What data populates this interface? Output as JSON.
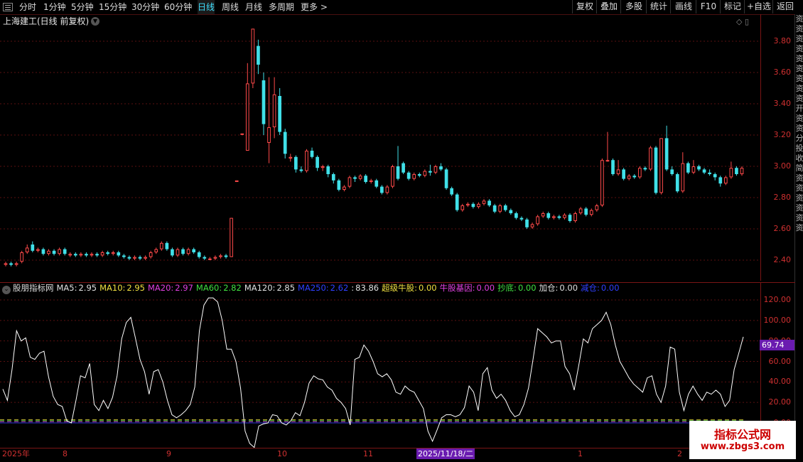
{
  "topbar": {
    "periods": [
      {
        "label": "分时",
        "active": false
      },
      {
        "label": "1分钟",
        "active": false
      },
      {
        "label": "5分钟",
        "active": false
      },
      {
        "label": "15分钟",
        "active": false
      },
      {
        "label": "30分钟",
        "active": false
      },
      {
        "label": "60分钟",
        "active": false
      },
      {
        "label": "日线",
        "active": true
      },
      {
        "label": "周线",
        "active": false
      },
      {
        "label": "月线",
        "active": false
      },
      {
        "label": "多周期",
        "active": false
      },
      {
        "label": "更多 >",
        "active": false
      }
    ],
    "actions": [
      "复权",
      "叠加",
      "多股",
      "统计",
      "画线",
      "F10",
      "标记",
      "+自选",
      "返回"
    ]
  },
  "stock": {
    "title": "上海建工(日线 前复权)"
  },
  "corner_icons": "◇ ▯",
  "price_axis": {
    "ticks": [
      "3.80",
      "3.60",
      "3.40",
      "3.20",
      "3.00",
      "2.80",
      "2.60",
      "2.40"
    ]
  },
  "side_strip": {
    "chars": [
      "资",
      "资",
      "资",
      "资",
      "资",
      "资",
      "资",
      "资",
      "资",
      "开",
      "资",
      "资",
      "分",
      "投",
      "收",
      "简",
      "资",
      "资",
      "资",
      "资",
      "资",
      "资"
    ]
  },
  "indicator": {
    "name": "股朋指标网",
    "items": [
      {
        "label": "MA5:",
        "value": "2.95",
        "color": "#e0e0e0"
      },
      {
        "label": "MA10:",
        "value": "2.95",
        "color": "#f0e040"
      },
      {
        "label": "MA20:",
        "value": "2.97",
        "color": "#e040e0"
      },
      {
        "label": "MA60:",
        "value": "2.82",
        "color": "#40e040"
      },
      {
        "label": "MA120:",
        "value": "2.85",
        "color": "#e0e0e0"
      },
      {
        "label": "MA250:",
        "value": "2.62",
        "color": "#3040ff"
      },
      {
        "label": ":",
        "value": "83.86",
        "color": "#e0e0e0"
      },
      {
        "label": "超级牛股:",
        "value": "0.00",
        "color": "#f0e040"
      },
      {
        "label": "牛股基因:",
        "value": "0.00",
        "color": "#e040e0"
      },
      {
        "label": "抄底:",
        "value": "0.00",
        "color": "#40e040"
      },
      {
        "label": "加仓:",
        "value": "0.00",
        "color": "#e0e0e0"
      },
      {
        "label": "减仓:",
        "value": "0.00",
        "color": "#3040ff"
      }
    ],
    "axis_ticks": [
      "120.00",
      "100.00",
      "80.00",
      "60.00",
      "40.00",
      "20.00",
      "0.00"
    ],
    "current_badge": "69.74"
  },
  "date_axis": {
    "labels": [
      {
        "text": "2025年",
        "selected": false
      },
      {
        "text": "8",
        "selected": false
      },
      {
        "text": "9",
        "selected": false
      },
      {
        "text": "10",
        "selected": false
      },
      {
        "text": "11",
        "selected": false
      },
      {
        "text": "2025/11/18/二",
        "selected": true
      },
      {
        "text": "1",
        "selected": false
      },
      {
        "text": "2",
        "selected": false
      }
    ]
  },
  "watermark": {
    "name": "指标公式网",
    "url": "www.zbgs3.com"
  },
  "colors": {
    "up": "#ff4a4a",
    "down": "#40e0e8",
    "grid": "#5a1010",
    "axis": "#d03030"
  },
  "chart_data": {
    "type": "candlestick",
    "ylim": [
      2.35,
      3.9
    ],
    "candles": [
      [
        2.37,
        2.38,
        2.39,
        2.36
      ],
      [
        2.38,
        2.37,
        2.39,
        2.36
      ],
      [
        2.37,
        2.38,
        2.39,
        2.36
      ],
      [
        2.39,
        2.45,
        2.46,
        2.38
      ],
      [
        2.45,
        2.48,
        2.5,
        2.44
      ],
      [
        2.5,
        2.46,
        2.52,
        2.45
      ],
      [
        2.46,
        2.47,
        2.48,
        2.45
      ],
      [
        2.47,
        2.44,
        2.48,
        2.43
      ],
      [
        2.44,
        2.46,
        2.47,
        2.43
      ],
      [
        2.46,
        2.44,
        2.47,
        2.43
      ],
      [
        2.44,
        2.47,
        2.48,
        2.43
      ],
      [
        2.47,
        2.44,
        2.48,
        2.43
      ],
      [
        2.43,
        2.44,
        2.45,
        2.42
      ],
      [
        2.44,
        2.43,
        2.45,
        2.42
      ],
      [
        2.43,
        2.44,
        2.45,
        2.42
      ],
      [
        2.44,
        2.43,
        2.45,
        2.42
      ],
      [
        2.43,
        2.44,
        2.45,
        2.42
      ],
      [
        2.44,
        2.43,
        2.45,
        2.42
      ],
      [
        2.43,
        2.45,
        2.46,
        2.42
      ],
      [
        2.45,
        2.44,
        2.46,
        2.43
      ],
      [
        2.44,
        2.45,
        2.46,
        2.43
      ],
      [
        2.45,
        2.43,
        2.46,
        2.42
      ],
      [
        2.43,
        2.42,
        2.44,
        2.41
      ],
      [
        2.42,
        2.41,
        2.43,
        2.4
      ],
      [
        2.41,
        2.42,
        2.43,
        2.4
      ],
      [
        2.42,
        2.41,
        2.43,
        2.4
      ],
      [
        2.41,
        2.42,
        2.43,
        2.4
      ],
      [
        2.42,
        2.45,
        2.46,
        2.41
      ],
      [
        2.45,
        2.47,
        2.48,
        2.44
      ],
      [
        2.47,
        2.51,
        2.52,
        2.46
      ],
      [
        2.51,
        2.47,
        2.52,
        2.46
      ],
      [
        2.47,
        2.43,
        2.48,
        2.42
      ],
      [
        2.43,
        2.47,
        2.48,
        2.42
      ],
      [
        2.47,
        2.44,
        2.48,
        2.43
      ],
      [
        2.44,
        2.47,
        2.48,
        2.43
      ],
      [
        2.47,
        2.45,
        2.48,
        2.44
      ],
      [
        2.45,
        2.42,
        2.46,
        2.41
      ],
      [
        2.42,
        2.41,
        2.43,
        2.4
      ],
      [
        2.41,
        2.41,
        2.42,
        2.4
      ],
      [
        2.41,
        2.42,
        2.43,
        2.4
      ],
      [
        2.42,
        2.43,
        2.44,
        2.41
      ],
      [
        2.43,
        2.42,
        2.44,
        2.41
      ],
      [
        2.42,
        2.67,
        2.67,
        2.42
      ],
      [
        2.9,
        2.91,
        2.91,
        2.9
      ],
      [
        3.21,
        3.21,
        3.21,
        3.21
      ],
      [
        3.1,
        3.53,
        3.66,
        3.1
      ],
      [
        3.53,
        3.88,
        3.88,
        3.5
      ],
      [
        3.77,
        3.65,
        3.81,
        3.59
      ],
      [
        3.55,
        3.27,
        3.6,
        3.2
      ],
      [
        3.15,
        3.25,
        3.57,
        3.02
      ],
      [
        3.25,
        3.46,
        3.57,
        3.18
      ],
      [
        3.45,
        3.22,
        3.5,
        3.2
      ],
      [
        3.22,
        3.08,
        3.24,
        3.05
      ],
      [
        3.05,
        3.06,
        3.08,
        3.03
      ],
      [
        3.06,
        2.98,
        3.07,
        2.96
      ],
      [
        2.98,
        2.97,
        3.0,
        2.96
      ],
      [
        2.97,
        3.1,
        3.11,
        2.96
      ],
      [
        3.1,
        3.06,
        3.12,
        3.05
      ],
      [
        3.06,
        2.99,
        3.07,
        2.97
      ],
      [
        2.99,
        3.0,
        3.01,
        2.97
      ],
      [
        3.0,
        2.95,
        3.01,
        2.93
      ],
      [
        2.95,
        2.91,
        2.96,
        2.89
      ],
      [
        2.91,
        2.85,
        2.92,
        2.84
      ],
      [
        2.85,
        2.87,
        2.88,
        2.84
      ],
      [
        2.87,
        2.93,
        2.94,
        2.86
      ],
      [
        2.93,
        2.92,
        2.94,
        2.9
      ],
      [
        2.92,
        2.94,
        2.95,
        2.91
      ],
      [
        2.94,
        2.9,
        2.95,
        2.89
      ],
      [
        2.9,
        2.91,
        2.92,
        2.89
      ],
      [
        2.91,
        2.87,
        2.92,
        2.86
      ],
      [
        2.87,
        2.83,
        2.88,
        2.82
      ],
      [
        2.83,
        2.87,
        2.88,
        2.82
      ],
      [
        2.87,
        3.0,
        3.01,
        2.86
      ],
      [
        3.0,
        2.92,
        3.13,
        2.91
      ],
      [
        3.02,
        2.96,
        3.03,
        2.95
      ],
      [
        2.96,
        2.92,
        2.97,
        2.91
      ],
      [
        2.92,
        2.95,
        2.96,
        2.91
      ],
      [
        2.95,
        2.94,
        2.96,
        2.93
      ],
      [
        2.94,
        2.97,
        2.98,
        2.93
      ],
      [
        2.97,
        2.96,
        3.01,
        2.94
      ],
      [
        2.96,
        3.0,
        3.01,
        2.95
      ],
      [
        3.0,
        2.98,
        3.02,
        2.97
      ],
      [
        2.98,
        2.86,
        2.99,
        2.85
      ],
      [
        2.86,
        2.82,
        2.87,
        2.81
      ],
      [
        2.82,
        2.72,
        2.83,
        2.71
      ],
      [
        2.72,
        2.75,
        2.76,
        2.71
      ],
      [
        2.75,
        2.76,
        2.77,
        2.74
      ],
      [
        2.76,
        2.74,
        2.77,
        2.73
      ],
      [
        2.74,
        2.76,
        2.77,
        2.73
      ],
      [
        2.76,
        2.78,
        2.79,
        2.75
      ],
      [
        2.78,
        2.75,
        2.79,
        2.74
      ],
      [
        2.75,
        2.71,
        2.76,
        2.7
      ],
      [
        2.71,
        2.75,
        2.76,
        2.7
      ],
      [
        2.75,
        2.72,
        2.76,
        2.71
      ],
      [
        2.72,
        2.7,
        2.73,
        2.69
      ],
      [
        2.7,
        2.67,
        2.71,
        2.66
      ],
      [
        2.67,
        2.66,
        2.68,
        2.65
      ],
      [
        2.66,
        2.61,
        2.67,
        2.6
      ],
      [
        2.61,
        2.63,
        2.64,
        2.6
      ],
      [
        2.63,
        2.68,
        2.69,
        2.62
      ],
      [
        2.68,
        2.7,
        2.71,
        2.67
      ],
      [
        2.7,
        2.67,
        2.71,
        2.66
      ],
      [
        2.67,
        2.68,
        2.69,
        2.66
      ],
      [
        2.68,
        2.67,
        2.69,
        2.66
      ],
      [
        2.67,
        2.69,
        2.7,
        2.66
      ],
      [
        2.69,
        2.65,
        2.7,
        2.64
      ],
      [
        2.65,
        2.7,
        2.71,
        2.64
      ],
      [
        2.7,
        2.73,
        2.74,
        2.69
      ],
      [
        2.73,
        2.69,
        2.74,
        2.68
      ],
      [
        2.69,
        2.72,
        2.73,
        2.68
      ],
      [
        2.72,
        2.75,
        2.76,
        2.71
      ],
      [
        2.75,
        3.04,
        3.05,
        2.74
      ],
      [
        3.04,
        3.04,
        3.22,
        3.03
      ],
      [
        3.04,
        2.95,
        3.05,
        2.94
      ],
      [
        2.95,
        2.98,
        3.04,
        2.94
      ],
      [
        2.98,
        2.92,
        2.99,
        2.91
      ],
      [
        2.92,
        2.94,
        2.95,
        2.91
      ],
      [
        2.94,
        2.93,
        2.95,
        2.92
      ],
      [
        2.93,
        2.99,
        3.0,
        2.92
      ],
      [
        2.99,
        2.98,
        3.0,
        2.97
      ],
      [
        2.98,
        3.12,
        3.13,
        2.97
      ],
      [
        3.12,
        2.83,
        3.13,
        2.82
      ],
      [
        2.83,
        3.18,
        3.18,
        2.82
      ],
      [
        3.18,
        2.98,
        3.26,
        2.97
      ],
      [
        2.98,
        2.95,
        3.0,
        2.94
      ],
      [
        2.95,
        2.84,
        2.96,
        2.83
      ],
      [
        2.84,
        3.02,
        3.09,
        2.83
      ],
      [
        3.02,
        2.96,
        3.03,
        2.95
      ],
      [
        2.96,
        3.0,
        3.04,
        2.95
      ],
      [
        3.0,
        2.98,
        3.01,
        2.97
      ],
      [
        2.98,
        2.96,
        2.99,
        2.95
      ],
      [
        2.96,
        2.95,
        2.98,
        2.94
      ],
      [
        2.95,
        2.93,
        2.96,
        2.91
      ],
      [
        2.93,
        2.89,
        2.94,
        2.87
      ],
      [
        2.89,
        2.93,
        2.94,
        2.88
      ],
      [
        2.93,
        2.99,
        3.03,
        2.92
      ],
      [
        2.99,
        2.95,
        3.0,
        2.94
      ],
      [
        2.95,
        2.99,
        3.0,
        2.94
      ]
    ],
    "indicator_line": [
      33,
      22,
      52,
      90,
      80,
      83,
      64,
      62,
      68,
      70,
      45,
      26,
      18,
      16,
      2,
      0,
      22,
      46,
      44,
      58,
      18,
      12,
      22,
      14,
      25,
      46,
      82,
      98,
      103,
      83,
      62,
      50,
      28,
      50,
      52,
      40,
      22,
      8,
      5,
      8,
      12,
      18,
      35,
      90,
      115,
      122,
      122,
      118,
      100,
      72,
      72,
      60,
      34,
      -8,
      -20,
      -24,
      -3,
      -1,
      0,
      8,
      7,
      0,
      -2,
      2,
      10,
      7,
      20,
      39,
      46,
      43,
      42,
      35,
      32,
      24,
      20,
      14,
      -2,
      62,
      64,
      76,
      70,
      60,
      48,
      45,
      48,
      42,
      30,
      28,
      36,
      32,
      30,
      22,
      14,
      -8,
      -18,
      -7,
      5,
      8,
      8,
      6,
      8,
      15,
      36,
      30,
      12,
      48,
      54,
      32,
      24,
      28,
      22,
      12,
      6,
      8,
      18,
      34,
      62,
      92,
      88,
      84,
      78,
      80,
      80,
      55,
      48,
      32,
      56,
      82,
      78,
      92,
      96,
      100,
      108,
      96,
      76,
      60,
      52,
      44,
      38,
      34,
      30,
      44,
      46,
      28,
      20,
      36,
      74,
      72,
      30,
      12,
      28,
      36,
      28,
      22,
      30,
      28,
      32,
      28,
      16,
      22,
      52,
      68,
      84
    ]
  }
}
